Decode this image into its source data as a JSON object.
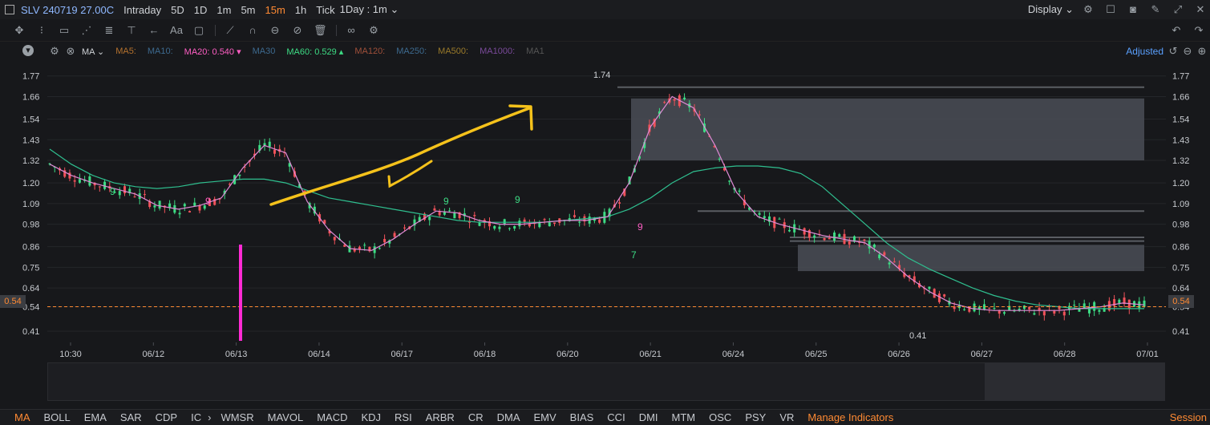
{
  "topbar": {
    "symbol": "SLV 240719 27.00C",
    "tabs": [
      "Intraday",
      "5D",
      "1D",
      "1m",
      "5m",
      "15m",
      "1h",
      "Tick"
    ],
    "active_tab": "15m",
    "interval_select": "1Day : 1m",
    "display_label": "Display"
  },
  "toolbar": {
    "text_tool": "Aa"
  },
  "ma_bar": {
    "type_label": "MA",
    "items": [
      {
        "label": "MA5:",
        "color": "#b5722e"
      },
      {
        "label": "MA10:",
        "color": "#3d6a8f"
      },
      {
        "label": "MA20: 0.540 ▾",
        "color": "#ff5ec4"
      },
      {
        "label": "MA30",
        "color": "#3d6a8f"
      },
      {
        "label": "MA60: 0.529 ▴",
        "color": "#3ddc84"
      },
      {
        "label": "MA120:",
        "color": "#a0503a"
      },
      {
        "label": "MA250:",
        "color": "#3d6a8f"
      },
      {
        "label": "MA500:",
        "color": "#9a7a2a"
      },
      {
        "label": "MA1000:",
        "color": "#7a4a9a"
      },
      {
        "label": "MA1",
        "color": "#555"
      }
    ],
    "adjusted_label": "Adjusted"
  },
  "chart_data": {
    "type": "candlestick",
    "y_ticks": [
      "1.77",
      "1.66",
      "1.54",
      "1.43",
      "1.32",
      "1.20",
      "1.09",
      "0.98",
      "0.86",
      "0.75",
      "0.64",
      "0.54",
      "0.41"
    ],
    "y_range": [
      0.35,
      1.82
    ],
    "x_ticks": [
      "10:30",
      "06/12",
      "06/13",
      "06/14",
      "06/17",
      "06/18",
      "06/20",
      "06/21",
      "06/24",
      "06/25",
      "06/26",
      "06/27",
      "06/28",
      "07/01"
    ],
    "current_price": "0.54",
    "high_label": "1.74",
    "low_label": "0.41",
    "ma20": [
      1.3,
      1.24,
      1.2,
      1.17,
      1.14,
      1.08,
      1.06,
      1.08,
      1.12,
      1.28,
      1.4,
      1.36,
      1.1,
      0.95,
      0.85,
      0.84,
      0.9,
      0.98,
      1.05,
      1.04,
      1.0,
      0.98,
      0.98,
      0.99,
      1.0,
      1.0,
      1.02,
      1.2,
      1.5,
      1.66,
      1.6,
      1.4,
      1.15,
      1.02,
      0.98,
      0.95,
      0.92,
      0.9,
      0.88,
      0.8,
      0.7,
      0.62,
      0.56,
      0.53,
      0.52,
      0.52,
      0.52,
      0.52,
      0.53,
      0.54,
      0.56,
      0.55
    ],
    "ma60": [
      1.38,
      1.3,
      1.24,
      1.2,
      1.18,
      1.17,
      1.18,
      1.2,
      1.21,
      1.22,
      1.22,
      1.2,
      1.16,
      1.12,
      1.1,
      1.08,
      1.06,
      1.04,
      1.02,
      1.0,
      0.99,
      0.99,
      0.99,
      0.99,
      1.0,
      1.01,
      1.02,
      1.06,
      1.12,
      1.2,
      1.26,
      1.28,
      1.29,
      1.29,
      1.28,
      1.25,
      1.18,
      1.08,
      0.98,
      0.88,
      0.8,
      0.74,
      0.69,
      0.64,
      0.6,
      0.57,
      0.55,
      0.54,
      0.53,
      0.53,
      0.53,
      0.53
    ],
    "signals": [
      "9",
      "9",
      "9",
      "9",
      "7",
      "9"
    ],
    "boxes": [
      {
        "y1": 1.65,
        "y2": 1.32
      },
      {
        "y1": 0.87,
        "y2": 0.73
      }
    ],
    "levels": [
      1.71,
      1.05,
      0.91,
      0.89
    ]
  },
  "indicators": {
    "items": [
      "MA",
      "BOLL",
      "EMA",
      "SAR",
      "CDP",
      "IC",
      "WMSR",
      "MAVOL",
      "MACD",
      "KDJ",
      "RSI",
      "ARBR",
      "CR",
      "DMA",
      "EMV",
      "BIAS",
      "CCI",
      "DMI",
      "MTM",
      "OSC",
      "PSY",
      "VR"
    ],
    "active": "MA",
    "manage_label": "Manage Indicators",
    "session_label": "Session"
  },
  "colors": {
    "up": "#3ddc84",
    "down": "#f0525a",
    "accent": "#ff8a33",
    "ma20": "#e08ad6",
    "ma60": "#2fbf8f",
    "annotation": "#f5c21b",
    "spike": "#ff2ad4"
  }
}
